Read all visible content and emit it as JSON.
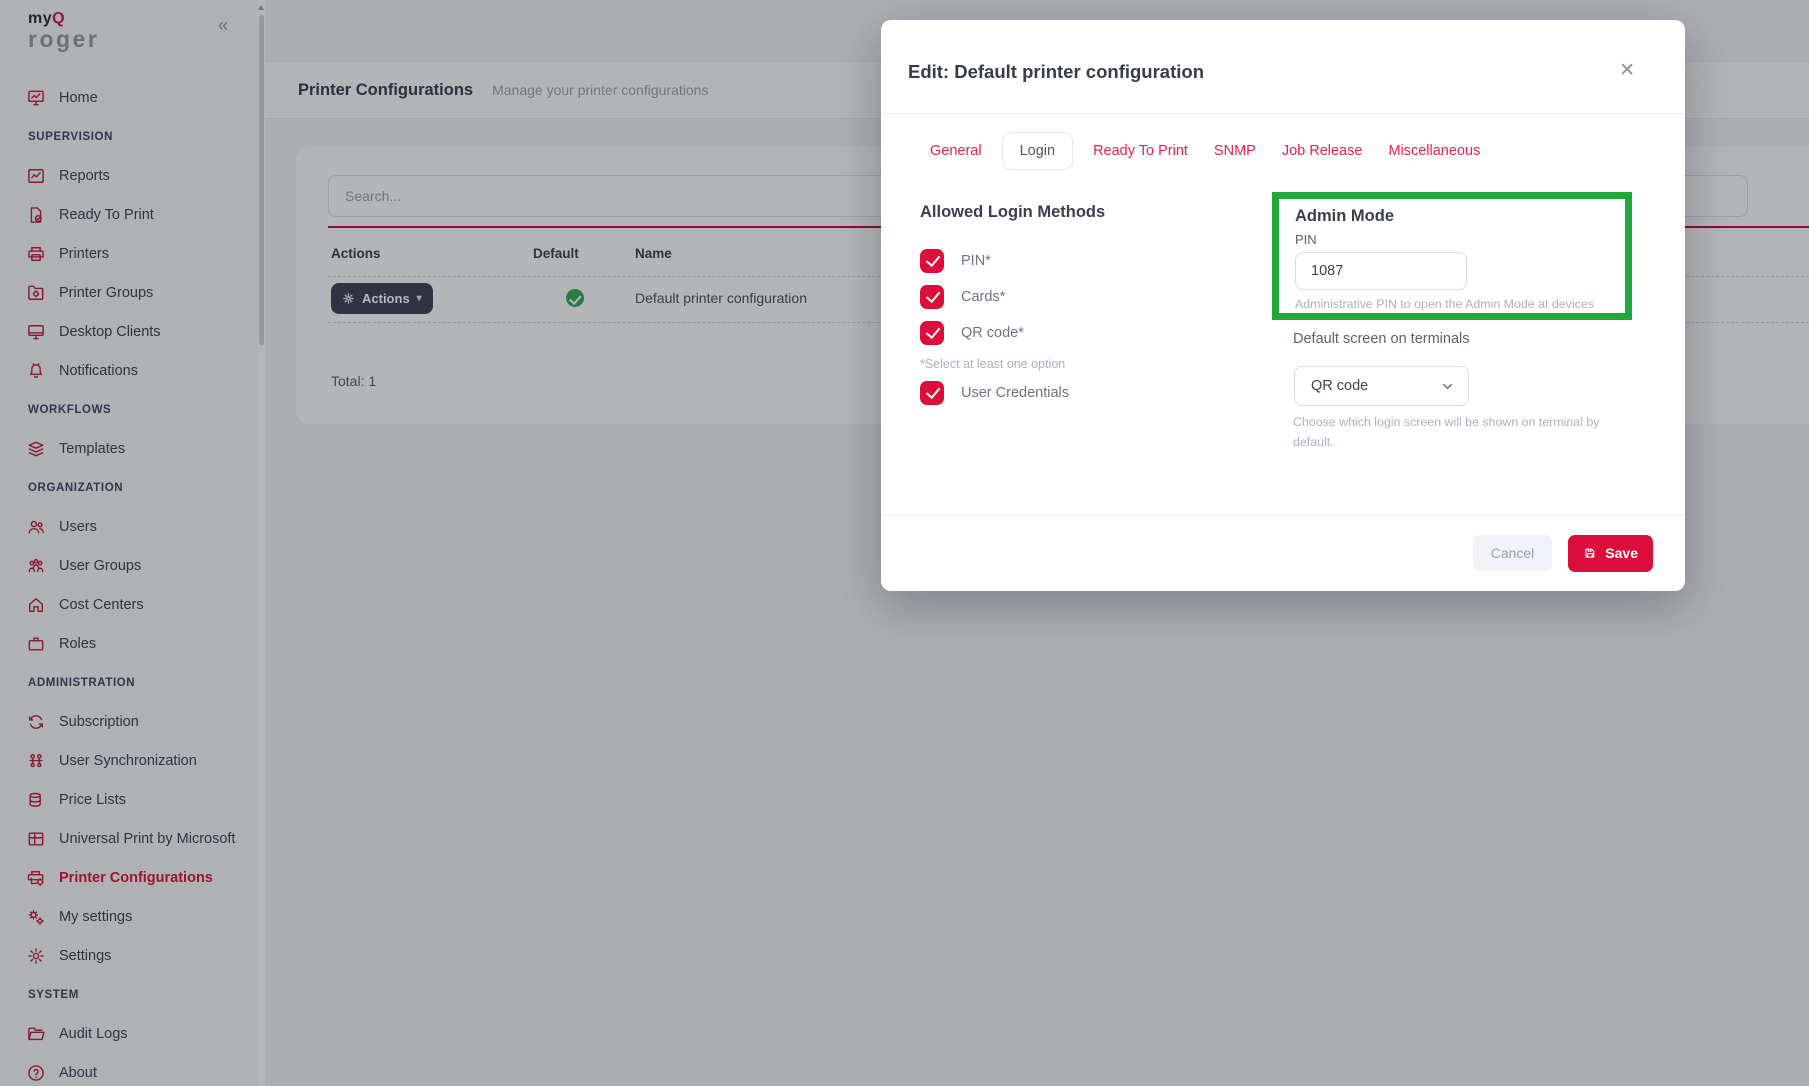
{
  "sidebar": {
    "logo": {
      "part1": "my",
      "part2": "Q",
      "part3": "roger"
    },
    "collapse_icon": "«",
    "sections": [
      {
        "header": null,
        "items": [
          {
            "label": "Home",
            "icon": "monitor-chart",
            "active": false
          }
        ]
      },
      {
        "header": "SUPERVISION",
        "items": [
          {
            "label": "Reports",
            "icon": "chart",
            "active": false
          },
          {
            "label": "Ready To Print",
            "icon": "doc-check",
            "active": false
          },
          {
            "label": "Printers",
            "icon": "printer",
            "active": false
          },
          {
            "label": "Printer Groups",
            "icon": "folder-gear",
            "active": false
          },
          {
            "label": "Desktop Clients",
            "icon": "monitor",
            "active": false
          },
          {
            "label": "Notifications",
            "icon": "bell",
            "active": false
          }
        ]
      },
      {
        "header": "WORKFLOWS",
        "items": [
          {
            "label": "Templates",
            "icon": "layers",
            "active": false
          }
        ]
      },
      {
        "header": "ORGANIZATION",
        "items": [
          {
            "label": "Users",
            "icon": "users",
            "active": false
          },
          {
            "label": "User Groups",
            "icon": "users-group",
            "active": false
          },
          {
            "label": "Cost Centers",
            "icon": "house",
            "active": false
          },
          {
            "label": "Roles",
            "icon": "briefcase",
            "active": false
          }
        ]
      },
      {
        "header": "ADMINISTRATION",
        "items": [
          {
            "label": "Subscription",
            "icon": "refresh",
            "active": false
          },
          {
            "label": "User Synchronization",
            "icon": "sync-users",
            "active": false
          },
          {
            "label": "Price Lists",
            "icon": "coins",
            "active": false
          },
          {
            "label": "Universal Print by Microsoft",
            "icon": "grid",
            "active": false
          },
          {
            "label": "Printer Configurations",
            "icon": "printer-gear",
            "active": true
          },
          {
            "label": "My settings",
            "icon": "gears",
            "active": false
          },
          {
            "label": "Settings",
            "icon": "gear",
            "active": false
          }
        ]
      },
      {
        "header": "SYSTEM",
        "items": [
          {
            "label": "Audit Logs",
            "icon": "folder-open",
            "active": false
          },
          {
            "label": "About",
            "icon": "question-circle",
            "active": false
          }
        ]
      }
    ]
  },
  "page": {
    "title": "Printer Configurations",
    "subtitle": "Manage your printer configurations",
    "search_placeholder": "Search...",
    "table": {
      "columns": [
        "Actions",
        "Default",
        "Name"
      ],
      "rows": [
        {
          "actions_label": "Actions",
          "default": true,
          "name": "Default printer configuration"
        }
      ],
      "total_label": "Total: 1"
    }
  },
  "modal": {
    "title": "Edit: Default printer configuration",
    "close_icon": "✕",
    "tabs": [
      {
        "label": "General",
        "active": false
      },
      {
        "label": "Login",
        "active": true
      },
      {
        "label": "Ready To Print",
        "active": false
      },
      {
        "label": "SNMP",
        "active": false
      },
      {
        "label": "Job Release",
        "active": false
      },
      {
        "label": "Miscellaneous",
        "active": false
      }
    ],
    "login_methods": {
      "heading": "Allowed Login Methods",
      "options": [
        {
          "label": "PIN*",
          "checked": true
        },
        {
          "label": "Cards*",
          "checked": true
        },
        {
          "label": "QR code*",
          "checked": true,
          "note": "*Select at least one option"
        },
        {
          "label": "User Credentials",
          "checked": true
        }
      ]
    },
    "admin_mode": {
      "heading": "Admin Mode",
      "pin_label": "PIN",
      "pin_value": "1087",
      "helper": "Administrative PIN to open the Admin Mode at devices"
    },
    "default_screen": {
      "label": "Default screen on terminals",
      "value": "QR code",
      "helper": "Choose which login screen will be shown on terminal by default."
    },
    "footer": {
      "cancel_label": "Cancel",
      "save_label": "Save"
    }
  },
  "colors": {
    "accent_red": "#dc0f3c",
    "tab_red": "#e8244c",
    "sidebar_icon_red": "#b91d3f",
    "green_highlight": "#22a73b",
    "success_green": "#3aa857",
    "dark_button": "#3e4152"
  }
}
